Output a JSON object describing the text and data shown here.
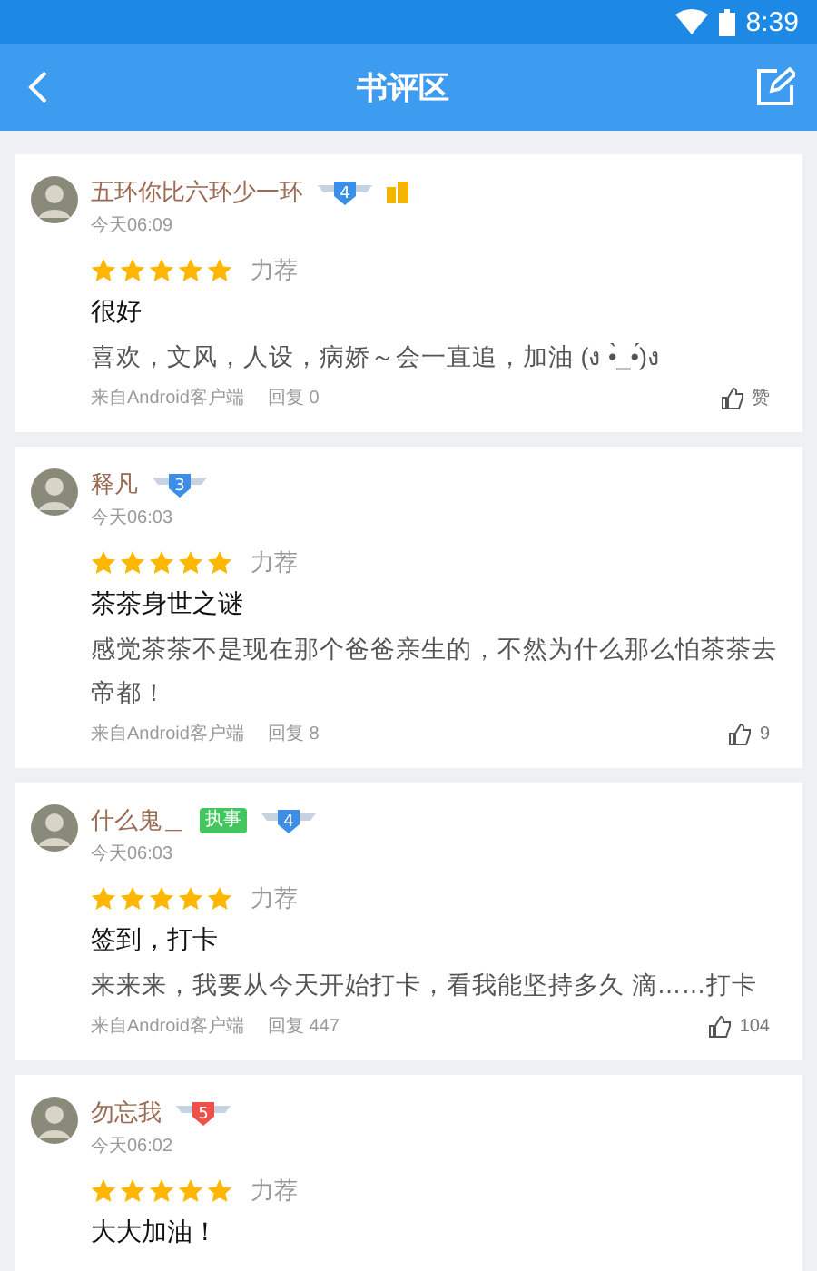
{
  "status_bar": {
    "time": "8:39"
  },
  "app_bar": {
    "title": "书评区"
  },
  "reviews": [
    {
      "user": "五环你比六环少一环",
      "level": {
        "text": "4",
        "color": "#3b8fe6"
      },
      "vip": true,
      "time": "今天06:09",
      "stars": 5,
      "rating_label": "力荐",
      "title": "很好",
      "body": "喜欢，文风，人设，病娇～会一直追，加油 (ง •̀_•́)ง",
      "source": "来自Android客户端",
      "replies": "回复 0",
      "likes": "赞"
    },
    {
      "user": "释凡",
      "level": {
        "text": "3",
        "color": "#3b8fe6"
      },
      "vip": false,
      "time": "今天06:03",
      "stars": 5,
      "rating_label": "力荐",
      "title": "茶茶身世之谜",
      "body": "感觉茶茶不是现在那个爸爸亲生的，不然为什么那么怕茶茶去帝都！",
      "source": "来自Android客户端",
      "replies": "回复 8",
      "likes": "9"
    },
    {
      "user": "什么鬼＿",
      "tag": "执事",
      "level": {
        "text": "4",
        "color": "#3b8fe6"
      },
      "vip": false,
      "time": "今天06:03",
      "stars": 5,
      "rating_label": "力荐",
      "title": "签到，打卡",
      "body": "来来来，我要从今天开始打卡，看我能坚持多久 滴……打卡",
      "source": "来自Android客户端",
      "replies": "回复 447",
      "likes": "104"
    },
    {
      "user": "勿忘我",
      "level": {
        "text": "5",
        "color": "#f0504a"
      },
      "vip": false,
      "time": "今天06:02",
      "stars": 5,
      "rating_label": "力荐",
      "title": "大大加油！"
    }
  ]
}
